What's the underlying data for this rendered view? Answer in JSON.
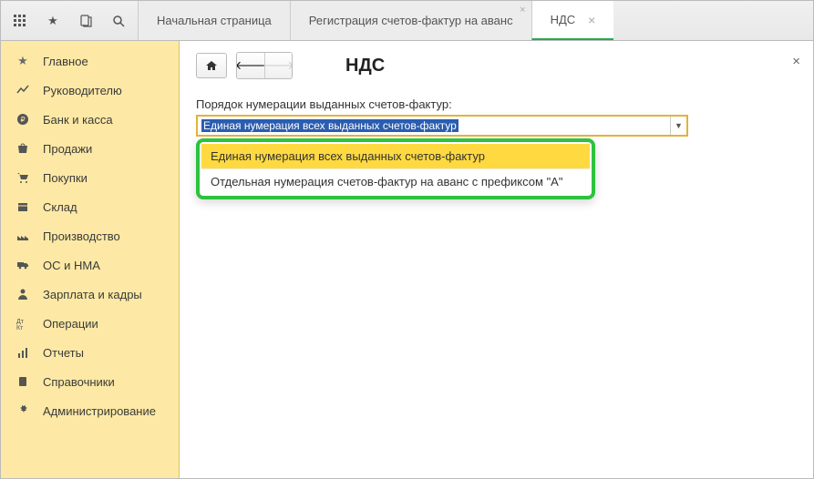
{
  "tabs": {
    "start": "Начальная страница",
    "reg": "Регистрация счетов-фактур на аванс",
    "nds": "НДС"
  },
  "sidebar": [
    {
      "icon": "star",
      "label": "Главное"
    },
    {
      "icon": "chart",
      "label": "Руководителю"
    },
    {
      "icon": "ruble",
      "label": "Банк и касса"
    },
    {
      "icon": "bag",
      "label": "Продажи"
    },
    {
      "icon": "cart",
      "label": "Покупки"
    },
    {
      "icon": "box",
      "label": "Склад"
    },
    {
      "icon": "factory",
      "label": "Производство"
    },
    {
      "icon": "truck",
      "label": "ОС и НМА"
    },
    {
      "icon": "person",
      "label": "Зарплата и кадры"
    },
    {
      "icon": "ops",
      "label": "Операции"
    },
    {
      "icon": "report",
      "label": "Отчеты"
    },
    {
      "icon": "book",
      "label": "Справочники"
    },
    {
      "icon": "gear",
      "label": "Администрирование"
    }
  ],
  "content": {
    "title": "НДС",
    "field_label": "Порядок нумерации выданных счетов-фактур:",
    "selected": "Единая нумерация всех выданных счетов-фактур",
    "options": [
      "Единая нумерация всех выданных счетов-фактур",
      "Отдельная нумерация счетов-фактур на аванс с префиксом \"А\""
    ]
  }
}
